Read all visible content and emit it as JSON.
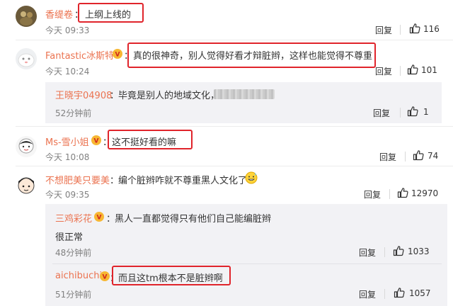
{
  "comments": [
    {
      "name": "香缇卷",
      "separator": "：",
      "text": "上纲上线的",
      "time": "今天 09:33",
      "reply": "回复",
      "likes": "116"
    },
    {
      "name": "Fantastic冰斯特",
      "separator": "：",
      "text": "真的很神奇，别人觉得好看才辩脏辫，这样也能觉得不尊重",
      "time": "今天 10:24",
      "reply": "回复",
      "likes": "101"
    },
    {
      "name": "王晓宇04908",
      "separator": "：",
      "text": "毕竟是别人的地域文化，",
      "time": "52分钟前",
      "reply": "回复",
      "likes": "1"
    },
    {
      "name": "Ms-雪小姐",
      "separator": "：",
      "text": "这不挺好看的嘛",
      "time": "今天 10:08",
      "reply": "回复",
      "likes": "74"
    },
    {
      "name": "不想肥美只要美",
      "separator": "：",
      "text": "编个脏辫咋就不尊重黑人文化了",
      "time": "今天 09:35",
      "reply": "回复",
      "likes": "12970"
    },
    {
      "name": "三鸡彩花",
      "separator": "：",
      "text": "黑人一直都觉得只有他们自己能编脏辫",
      "text2": "很正常",
      "time": "48分钟前",
      "reply": "回复",
      "likes": "1033"
    },
    {
      "name": "aichibuchi",
      "separator": "：",
      "text": "而且这tm根本不是脏辫啊",
      "time": "51分钟前",
      "reply": "回复",
      "likes": "1057"
    }
  ],
  "icons": {
    "like": "thumbs-up-icon",
    "badge": "vip-badge-icon",
    "emoji": "grin-sweat-emoji-icon"
  },
  "colors": {
    "name": "#eb7350",
    "highlight_box": "#e0242b",
    "nested_bg": "#f2f2f5"
  }
}
